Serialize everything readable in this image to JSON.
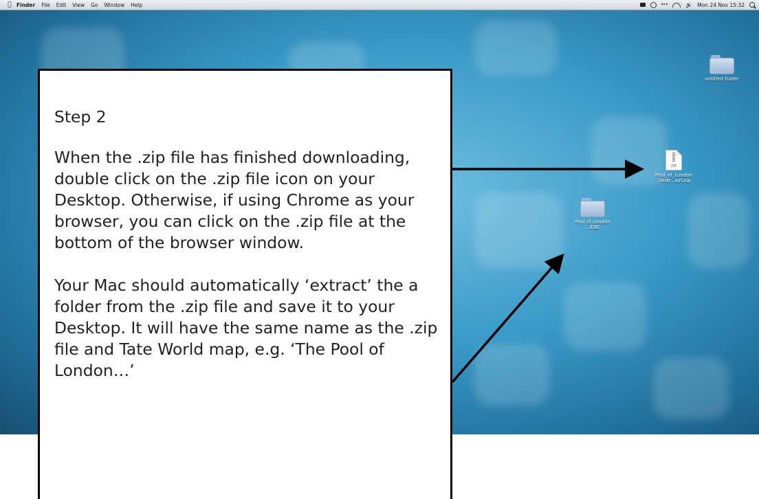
{
  "menubar": {
    "apple_icon": "apple-icon",
    "menus": [
      "Finder",
      "File",
      "Edit",
      "View",
      "Go",
      "Window",
      "Help"
    ],
    "status_icons": [
      "screen-mirroring-icon",
      "time-machine-icon",
      "bluetooth-icon",
      "wifi-icon",
      "volume-icon"
    ],
    "clock": "Mon 24 Nov 15:32",
    "spotlight_icon": "spotlight-search-icon"
  },
  "desktop": {
    "icons": [
      {
        "label": "untitled folder",
        "type": "folder"
      },
      {
        "label_line1": "Pool_of_London",
        "label_line2": "_Andr...ain.zip",
        "type": "zip",
        "doc_text": "ZIP"
      },
      {
        "label_line1": "Pool of London",
        "label_line2": "...ERE",
        "type": "folder"
      }
    ]
  },
  "callout": {
    "title": "Step 2",
    "paragraph1": "When the .zip file has finished downloading, double click on the .zip file icon on your Desktop. Otherwise, if using Chrome as your browser, you can click on the .zip file at the bottom of the browser window.",
    "paragraph2": "Your Mac should automatically ‘extract’ the a folder from the .zip file and save it to your Desktop. It will have the same name as the .zip file and Tate World map, e.g. ‘The Pool of London…’"
  },
  "colors": {
    "desktop_blue": "#3a99c6",
    "arrow": "#000000",
    "callout_border": "#000000"
  }
}
